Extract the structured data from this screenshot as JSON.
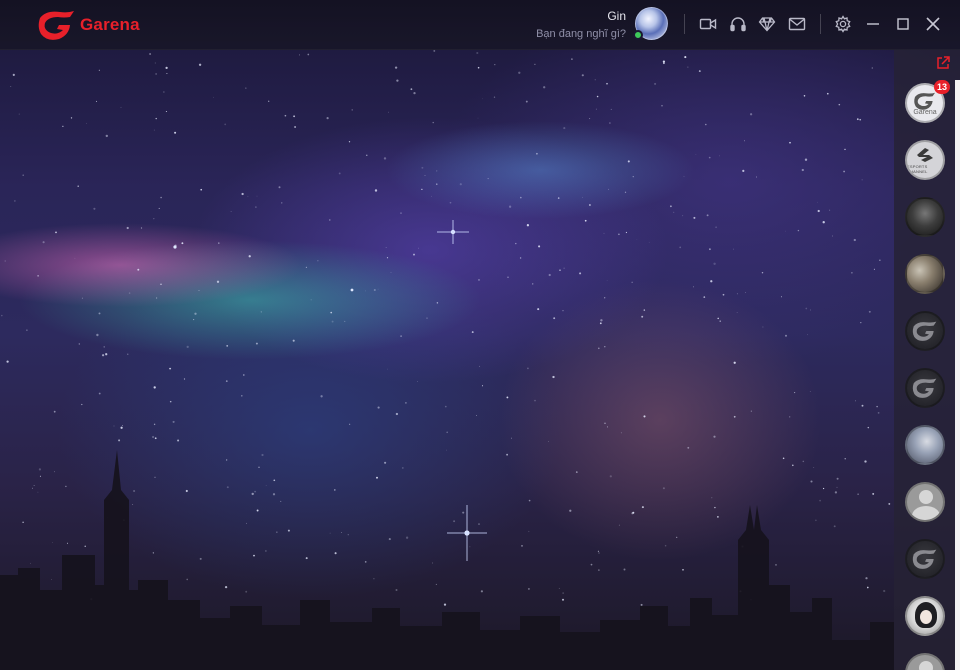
{
  "app": {
    "brand": "Garena",
    "brand_color": "#e8202a"
  },
  "user": {
    "name": "Gin",
    "status_placeholder": "Bạn đang nghĩ gì?",
    "online_color": "#3ec95a"
  },
  "toolbar": {
    "icons": [
      "video-camera-icon",
      "headset-icon",
      "diamond-icon",
      "mail-icon",
      "settings-icon",
      "minimize-icon",
      "maximize-icon",
      "close-icon"
    ]
  },
  "sidebar": {
    "badge_count": "13",
    "items": [
      {
        "name": "garena-channel",
        "avatar_text": "Garena"
      },
      {
        "name": "esports-channel",
        "avatar_text": "ESPORTS CHANNEL"
      },
      {
        "name": "contact-dark-warrior"
      },
      {
        "name": "contact-mushroom"
      },
      {
        "name": "contact-garena-1"
      },
      {
        "name": "contact-garena-2"
      },
      {
        "name": "contact-elf"
      },
      {
        "name": "contact-default"
      },
      {
        "name": "contact-garena-3"
      },
      {
        "name": "contact-girl"
      }
    ]
  }
}
